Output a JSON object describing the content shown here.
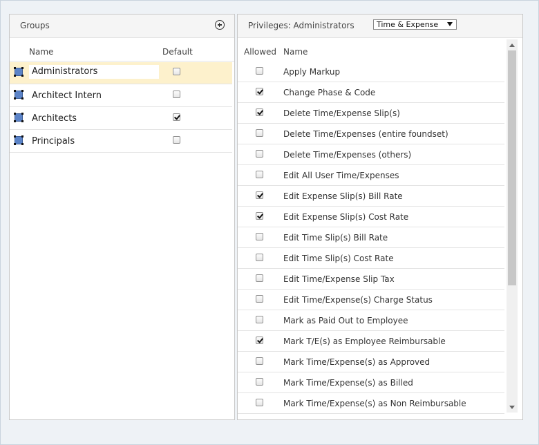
{
  "groups_panel": {
    "title": "Groups",
    "add_icon": "plus-circle-icon",
    "columns": {
      "name": "Name",
      "default": "Default"
    },
    "rows": [
      {
        "name": "Administrators",
        "default": false,
        "selected": true
      },
      {
        "name": "Architect Intern",
        "default": false,
        "selected": false
      },
      {
        "name": "Architects",
        "default": true,
        "selected": false
      },
      {
        "name": "Principals",
        "default": false,
        "selected": false
      }
    ]
  },
  "privileges_panel": {
    "title": "Privileges: Administrators",
    "category_select": {
      "value": "Time & Expense"
    },
    "columns": {
      "allowed": "Allowed",
      "name": "Name"
    },
    "rows": [
      {
        "name": "Apply Markup",
        "allowed": false
      },
      {
        "name": "Change Phase & Code",
        "allowed": true
      },
      {
        "name": "Delete Time/Expense Slip(s)",
        "allowed": true
      },
      {
        "name": "Delete Time/Expenses (entire foundset)",
        "allowed": false
      },
      {
        "name": "Delete Time/Expenses (others)",
        "allowed": false
      },
      {
        "name": "Edit All User Time/Expenses",
        "allowed": false
      },
      {
        "name": "Edit Expense Slip(s) Bill Rate",
        "allowed": true
      },
      {
        "name": "Edit Expense Slip(s) Cost Rate",
        "allowed": true
      },
      {
        "name": "Edit Time Slip(s) Bill Rate",
        "allowed": false
      },
      {
        "name": "Edit Time Slip(s) Cost Rate",
        "allowed": false
      },
      {
        "name": "Edit Time/Expense Slip Tax",
        "allowed": false
      },
      {
        "name": "Edit Time/Expense(s) Charge Status",
        "allowed": false
      },
      {
        "name": "Mark as Paid Out to Employee",
        "allowed": false
      },
      {
        "name": "Mark T/E(s) as Employee Reimbursable",
        "allowed": true
      },
      {
        "name": "Mark Time/Expense(s) as Approved",
        "allowed": false
      },
      {
        "name": "Mark Time/Expense(s) as Billed",
        "allowed": false
      },
      {
        "name": "Mark Time/Expense(s) as Non Reimbursable",
        "allowed": false
      }
    ]
  },
  "colors": {
    "selected_row": "#fdf1cc",
    "group_icon": "#5b83c7",
    "panel_header": "#f5f5f5"
  }
}
